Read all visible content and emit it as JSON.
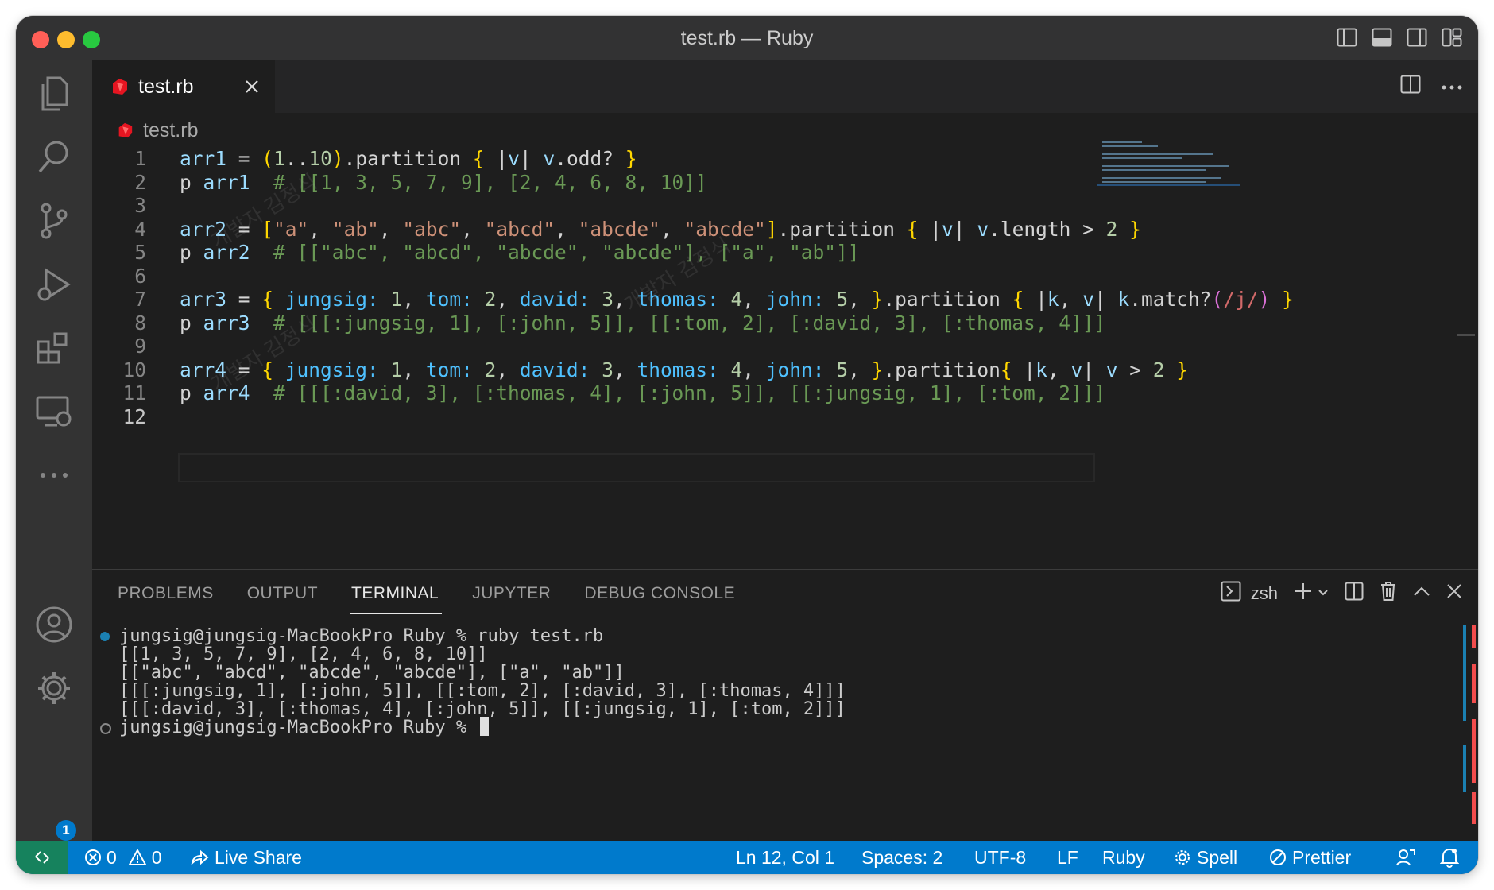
{
  "window": {
    "title": "test.rb — Ruby",
    "traffic_lights": [
      "#ff5f57",
      "#febc2e",
      "#28c840"
    ]
  },
  "activity_bar": {
    "items": [
      "files-icon",
      "search-icon",
      "source-control-icon",
      "run-debug-icon",
      "extensions-icon",
      "remote-explorer-icon",
      "more-icon"
    ],
    "bottom": [
      "account-icon",
      "manage-gear-icon"
    ],
    "settings_badge": "1"
  },
  "editor": {
    "tab": {
      "label": "test.rb",
      "icon": "ruby-gem-icon"
    },
    "breadcrumb": "test.rb",
    "active_line": "12",
    "lines": [
      {
        "n": "1",
        "t": [
          [
            "arr1",
            "var"
          ],
          [
            " = ",
            ""
          ],
          [
            "(",
            "bracket-y"
          ],
          [
            "1",
            "num"
          ],
          [
            "..",
            ""
          ],
          [
            "10",
            "num"
          ],
          [
            ")",
            "bracket-y"
          ],
          [
            ".partition ",
            ""
          ],
          [
            "{",
            "bracket-y"
          ],
          [
            " |",
            ""
          ],
          [
            "v",
            "var"
          ],
          [
            "| ",
            ""
          ],
          [
            "v",
            "var"
          ],
          [
            ".odd? ",
            ""
          ],
          [
            "}",
            "bracket-y"
          ]
        ]
      },
      {
        "n": "2",
        "t": [
          [
            "p ",
            ""
          ],
          [
            "arr1",
            "var"
          ],
          [
            "  # [[1, 3, 5, 7, 9], [2, 4, 6, 8, 10]]",
            "comment"
          ]
        ]
      },
      {
        "n": "3",
        "t": []
      },
      {
        "n": "4",
        "t": [
          [
            "arr2",
            "var"
          ],
          [
            " = ",
            ""
          ],
          [
            "[",
            "bracket-y"
          ],
          [
            "\"a\"",
            "str"
          ],
          [
            ", ",
            ""
          ],
          [
            "\"ab\"",
            "str"
          ],
          [
            ", ",
            ""
          ],
          [
            "\"abc\"",
            "str"
          ],
          [
            ", ",
            ""
          ],
          [
            "\"abcd\"",
            "str"
          ],
          [
            ", ",
            ""
          ],
          [
            "\"abcde\"",
            "str"
          ],
          [
            ", ",
            ""
          ],
          [
            "\"abcde\"",
            "str"
          ],
          [
            "]",
            "bracket-y"
          ],
          [
            ".partition ",
            ""
          ],
          [
            "{",
            "bracket-y"
          ],
          [
            " |",
            ""
          ],
          [
            "v",
            "var"
          ],
          [
            "| ",
            ""
          ],
          [
            "v",
            "var"
          ],
          [
            ".length > ",
            ""
          ],
          [
            "2",
            "num"
          ],
          [
            " ",
            ""
          ],
          [
            "}",
            "bracket-y"
          ]
        ]
      },
      {
        "n": "5",
        "t": [
          [
            "p ",
            ""
          ],
          [
            "arr2",
            "var"
          ],
          [
            "  # [[\"abc\", \"abcd\", \"abcde\", \"abcde\"], [\"a\", \"ab\"]]",
            "comment"
          ]
        ]
      },
      {
        "n": "6",
        "t": []
      },
      {
        "n": "7",
        "t": [
          [
            "arr3",
            "var"
          ],
          [
            " = ",
            ""
          ],
          [
            "{",
            "bracket-y"
          ],
          [
            " jungsig:",
            "sym"
          ],
          [
            " ",
            ""
          ],
          [
            "1",
            "num"
          ],
          [
            ", ",
            ""
          ],
          [
            "tom:",
            "sym"
          ],
          [
            " ",
            ""
          ],
          [
            "2",
            "num"
          ],
          [
            ", ",
            ""
          ],
          [
            "david:",
            "sym"
          ],
          [
            " ",
            ""
          ],
          [
            "3",
            "num"
          ],
          [
            ", ",
            ""
          ],
          [
            "thomas:",
            "sym"
          ],
          [
            " ",
            ""
          ],
          [
            "4",
            "num"
          ],
          [
            ", ",
            ""
          ],
          [
            "john:",
            "sym"
          ],
          [
            " ",
            ""
          ],
          [
            "5",
            "num"
          ],
          [
            ", ",
            ""
          ],
          [
            "}",
            "bracket-y"
          ],
          [
            ".partition ",
            ""
          ],
          [
            "{",
            "bracket-y"
          ],
          [
            " |",
            ""
          ],
          [
            "k",
            "var"
          ],
          [
            ", ",
            ""
          ],
          [
            "v",
            "var"
          ],
          [
            "| ",
            ""
          ],
          [
            "k",
            "var"
          ],
          [
            ".match?",
            ""
          ],
          [
            "(",
            "bracket-p"
          ],
          [
            "/j/",
            "regex"
          ],
          [
            ")",
            "bracket-p"
          ],
          [
            " ",
            ""
          ],
          [
            "}",
            "bracket-y"
          ]
        ]
      },
      {
        "n": "8",
        "t": [
          [
            "p ",
            ""
          ],
          [
            "arr3",
            "var"
          ],
          [
            "  # [[[:jungsig, 1], [:john, 5]], [[:tom, 2], [:david, 3], [:thomas, 4]]]",
            "comment"
          ]
        ]
      },
      {
        "n": "9",
        "t": []
      },
      {
        "n": "10",
        "t": [
          [
            "arr4",
            "var"
          ],
          [
            " = ",
            ""
          ],
          [
            "{",
            "bracket-y"
          ],
          [
            " jungsig:",
            "sym"
          ],
          [
            " ",
            ""
          ],
          [
            "1",
            "num"
          ],
          [
            ", ",
            ""
          ],
          [
            "tom:",
            "sym"
          ],
          [
            " ",
            ""
          ],
          [
            "2",
            "num"
          ],
          [
            ", ",
            ""
          ],
          [
            "david:",
            "sym"
          ],
          [
            " ",
            ""
          ],
          [
            "3",
            "num"
          ],
          [
            ", ",
            ""
          ],
          [
            "thomas:",
            "sym"
          ],
          [
            " ",
            ""
          ],
          [
            "4",
            "num"
          ],
          [
            ", ",
            ""
          ],
          [
            "john:",
            "sym"
          ],
          [
            " ",
            ""
          ],
          [
            "5",
            "num"
          ],
          [
            ", ",
            ""
          ],
          [
            "}",
            "bracket-y"
          ],
          [
            ".partition",
            ""
          ],
          [
            "{",
            "bracket-y"
          ],
          [
            " |",
            ""
          ],
          [
            "k",
            "var"
          ],
          [
            ", ",
            ""
          ],
          [
            "v",
            "var"
          ],
          [
            "| ",
            ""
          ],
          [
            "v",
            "var"
          ],
          [
            " > ",
            ""
          ],
          [
            "2",
            "num"
          ],
          [
            " ",
            ""
          ],
          [
            "}",
            "bracket-y"
          ]
        ]
      },
      {
        "n": "11",
        "t": [
          [
            "p ",
            ""
          ],
          [
            "arr4",
            "var"
          ],
          [
            "  # [[[:david, 3], [:thomas, 4], [:john, 5]], [[:jungsig, 1], [:tom, 2]]]",
            "comment"
          ]
        ]
      },
      {
        "n": "12",
        "t": []
      }
    ],
    "watermark": "개발자 김정식"
  },
  "panel": {
    "tabs": [
      "PROBLEMS",
      "OUTPUT",
      "TERMINAL",
      "JUPYTER",
      "DEBUG CONSOLE"
    ],
    "active_tab": "TERMINAL",
    "shell": "zsh",
    "terminal_lines": [
      {
        "marker": "filled",
        "text": "jungsig@jungsig-MacBookPro Ruby % ruby test.rb"
      },
      {
        "marker": "",
        "text": "[[1, 3, 5, 7, 9], [2, 4, 6, 8, 10]]"
      },
      {
        "marker": "",
        "text": "[[\"abc\", \"abcd\", \"abcde\", \"abcde\"], [\"a\", \"ab\"]]"
      },
      {
        "marker": "",
        "text": "[[[:jungsig, 1], [:john, 5]], [[:tom, 2], [:david, 3], [:thomas, 4]]]"
      },
      {
        "marker": "",
        "text": "[[[:david, 3], [:thomas, 4], [:john, 5]], [[:jungsig, 1], [:tom, 2]]]"
      },
      {
        "marker": "hollow",
        "text": "jungsig@jungsig-MacBookPro Ruby % "
      }
    ]
  },
  "statusbar": {
    "errors": "0",
    "warnings": "0",
    "live_share": "Live Share",
    "position": "Ln 12, Col 1",
    "spaces": "Spaces: 2",
    "encoding": "UTF-8",
    "eol": "LF",
    "language": "Ruby",
    "spell": "Spell",
    "prettier": "Prettier",
    "colors": {
      "bar": "#007acc",
      "remote": "#16825d"
    }
  },
  "theme": {
    "var": "#9cdcfe",
    "num": "#b5cea8",
    "str": "#ce9178",
    "comment": "#6a9955",
    "sym": "#4fc1ff",
    "regex": "#d16969",
    "bracket-y": "#ffd700",
    "bracket-p": "#da70d6",
    "default": "#d4d4d4"
  }
}
